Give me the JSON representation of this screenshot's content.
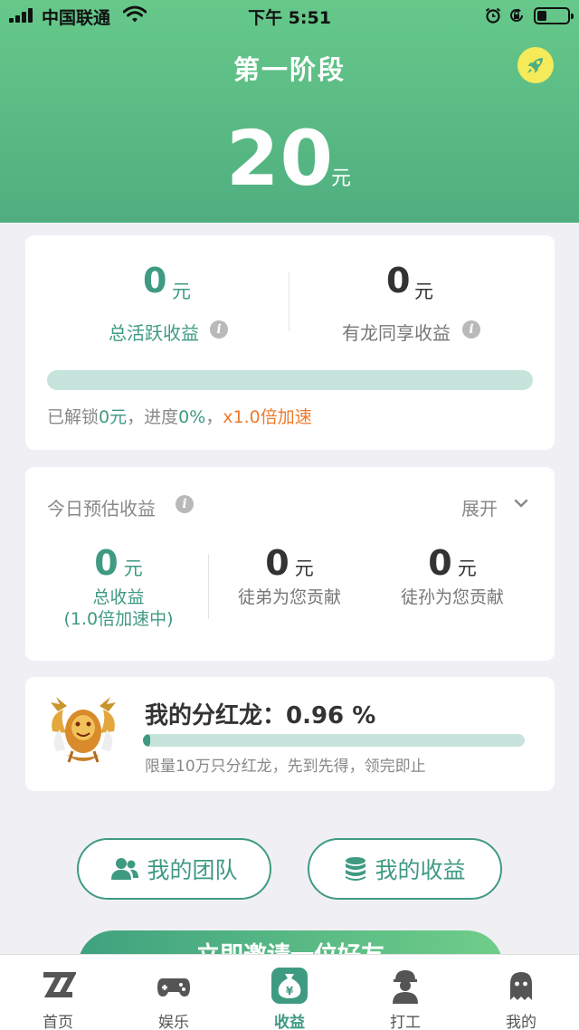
{
  "status_bar": {
    "carrier": "中国联通",
    "time": "下午 5:51"
  },
  "header": {
    "stage_title": "第一阶段",
    "amount": "20",
    "unit": "元"
  },
  "summary_card": {
    "active_income": {
      "value": "0",
      "unit": "元",
      "label": "总活跃收益"
    },
    "shared_income": {
      "value": "0",
      "unit": "元",
      "label": "有龙同享收益"
    },
    "progress_fraction": 0.0,
    "status": {
      "part1": "已解锁",
      "unlocked_value": "0元",
      "part2": "，进度",
      "progress_text": "0%",
      "part3": "，",
      "speed_text": "x1.0倍加速"
    }
  },
  "today_card": {
    "title": "今日预估收益",
    "expand_label": "展开",
    "columns": [
      {
        "value": "0",
        "unit": "元",
        "label": "总收益",
        "sublabel": "(1.0倍加速中)"
      },
      {
        "value": "0",
        "unit": "元",
        "label": "徒弟为您贡献"
      },
      {
        "value": "0",
        "unit": "元",
        "label": "徒孙为您贡献"
      }
    ]
  },
  "dragon_card": {
    "title": "我的分红龙：0.96 %",
    "progress_fraction": 0.0096,
    "note": "限量10万只分红龙，先到先得，领完即止"
  },
  "buttons": {
    "team": "我的团队",
    "income": "我的收益",
    "invite": "立即邀请一位好友"
  },
  "tabbar": {
    "items": [
      {
        "label": "首页",
        "icon": "home-z-icon"
      },
      {
        "label": "娱乐",
        "icon": "gamepad-icon"
      },
      {
        "label": "收益",
        "icon": "money-bag-icon",
        "active": true
      },
      {
        "label": "打工",
        "icon": "worker-icon"
      },
      {
        "label": "我的",
        "icon": "ghost-profile-icon"
      }
    ]
  },
  "colors": {
    "brand_green": "#3f9a82",
    "header_green": "#5fbd86",
    "accent_orange": "#ee7a2d",
    "rocket_yellow": "#f4ea5a"
  }
}
